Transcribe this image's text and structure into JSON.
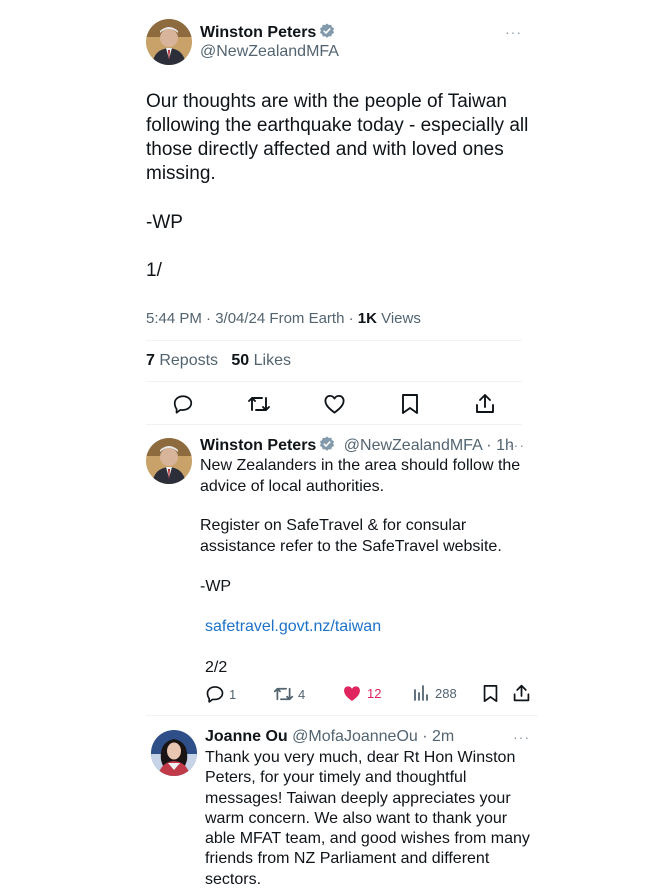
{
  "main_tweet": {
    "author_name": "Winston Peters",
    "author_handle": "@NewZealandMFA",
    "more_label": "···",
    "text_lines": [
      "Our thoughts are with the people of Taiwan",
      "following the earthquake today - especially all",
      "those directly affected and with loved ones",
      "missing."
    ],
    "signature": "-WP",
    "thread_marker": "1/",
    "timestamp": "5:44 PM · 3/04/24 From Earth · ",
    "views_count": "1K",
    "views_label": " Views",
    "reposts_count": "7",
    "reposts_label": " Reposts",
    "likes_count": "50",
    "likes_label": " Likes"
  },
  "reply1": {
    "author_name": "Winston Peters",
    "author_handle": "@NewZealandMFA · 1h",
    "more_label": "···",
    "para1_lines": [
      "New Zealanders in the area should follow the",
      "advice of local authorities."
    ],
    "para2_lines": [
      "Register on SafeTravel & for consular",
      "assistance refer to the SafeTravel website."
    ],
    "signature": "-WP",
    "link": "safetravel.govt.nz/taiwan",
    "thread_marker": "2/2",
    "reply_count": "1",
    "repost_count": "4",
    "like_count": "12",
    "view_count": "288"
  },
  "reply2": {
    "author_name": "Joanne Ou",
    "author_handle": "@MofaJoanneOu · 2m",
    "more_label": "···",
    "text_lines": [
      "Thank you very much, dear Rt Hon Winston",
      "Peters, for your timely and thoughtful",
      "messages! Taiwan deeply appreciates your",
      "warm concern. We also want to thank your",
      "able MFAT team, and good wishes from many",
      "friends from NZ Parliament and different",
      "sectors."
    ]
  },
  "colors": {
    "verified": "#829aab",
    "like_active": "#e0245e",
    "link": "#1d72c8",
    "secondary_text": "#536471"
  }
}
